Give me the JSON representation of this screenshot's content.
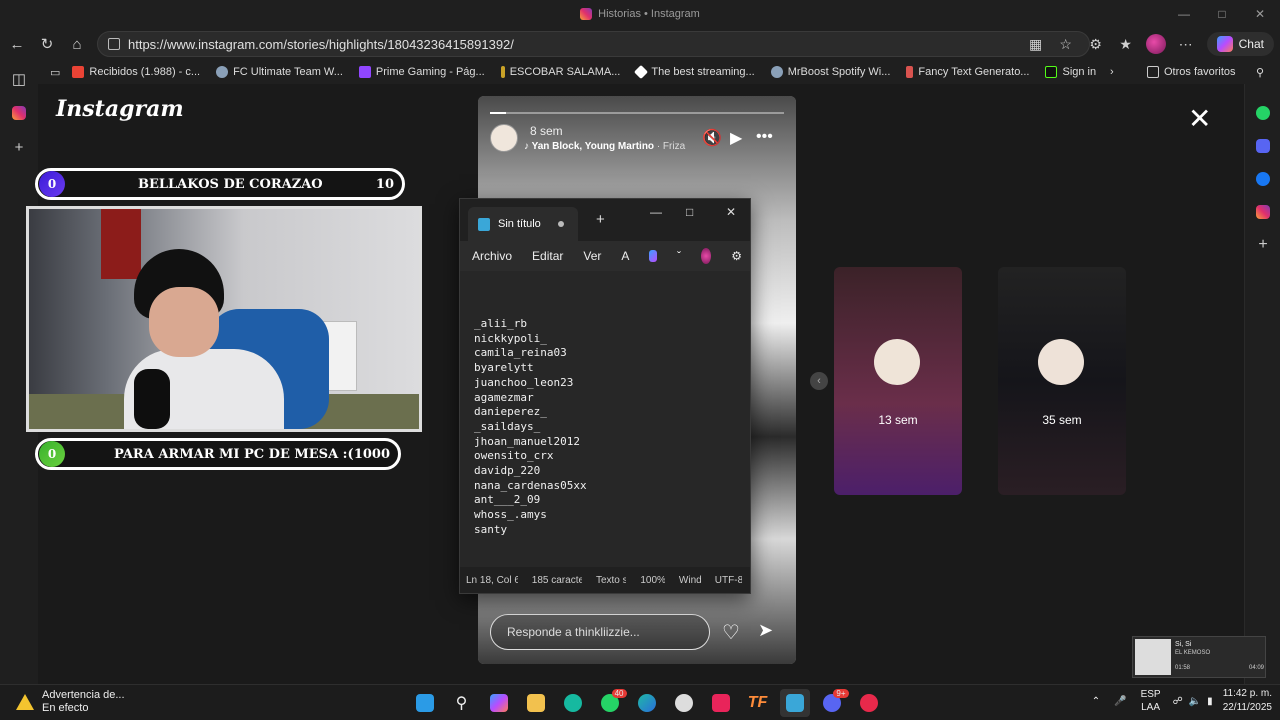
{
  "window": {
    "title": "Historias • Instagram"
  },
  "address": {
    "url": "https://www.instagram.com/stories/highlights/18043236415891392/"
  },
  "toolbar": {
    "chat_label": "Chat"
  },
  "favorites": [
    {
      "label": "Recibidos (1.988) - c...",
      "color": "#ea4335"
    },
    {
      "label": "FC Ultimate Team W...",
      "color": "#8aa0b8"
    },
    {
      "label": "Prime Gaming - Pág...",
      "color": "#9146ff"
    },
    {
      "label": "ESCOBAR SALAMA...",
      "color": "#c9a227"
    },
    {
      "label": "The best streaming...",
      "color": "#ffffff"
    },
    {
      "label": "MrBoost Spotify Wi...",
      "color": "#8aa0b8"
    },
    {
      "label": "Fancy Text Generato...",
      "color": "#d9534f"
    },
    {
      "label": "Sign in",
      "color": "#53fc18"
    }
  ],
  "favorites_other": "Otros favoritos",
  "instagram": {
    "logo": "Instagram"
  },
  "overlay": {
    "goal1": {
      "left": "0",
      "title": "BELLAKOS DE CORAZAO",
      "right": "10"
    },
    "goal2": {
      "left": "0",
      "title": "PARA ARMAR MI PC DE MESA :(",
      "right": "1000"
    }
  },
  "story": {
    "time": "8 sem",
    "song_artist": "Yan Block, Young Martino",
    "song_title": "· Friza",
    "reply_placeholder": "Responde a thinkliizzie..."
  },
  "notepad": {
    "tab_title": "Sin título",
    "menu": [
      "Archivo",
      "Editar",
      "Ver"
    ],
    "lines": [
      "_alii_rb",
      "nickkypoli_",
      "camila_reina03",
      "byarelytt",
      "juanchoo_leon23",
      "agamezmar",
      "danieperez_",
      "_saildays_",
      "jhoan_manuel2012",
      "owensito_crx",
      "davidp_220",
      "nana_cardenas05xx",
      "ant___2_09",
      "whoss_.amys",
      "santy"
    ],
    "status": {
      "position": "Ln 18, Col 6",
      "chars": "185 caracte",
      "format": "Texto s",
      "zoom": "100%",
      "eol": "Wind",
      "encoding": "UTF-8"
    }
  },
  "cards": [
    {
      "label": "13 sem"
    },
    {
      "label": "35 sem"
    }
  ],
  "taskbar": {
    "warning_title": "Advertencia de...",
    "warning_sub": "En efecto",
    "lang1": "ESP",
    "lang2": "LAA",
    "time": "11:42 p. m.",
    "date": "22/11/2025",
    "whatsapp_badge": "40",
    "discord_badge": "9+"
  },
  "mini_player": {
    "title": "Si, Si",
    "artist": "EL KEMOSO",
    "elapsed": "01:58",
    "total": "04:09"
  }
}
